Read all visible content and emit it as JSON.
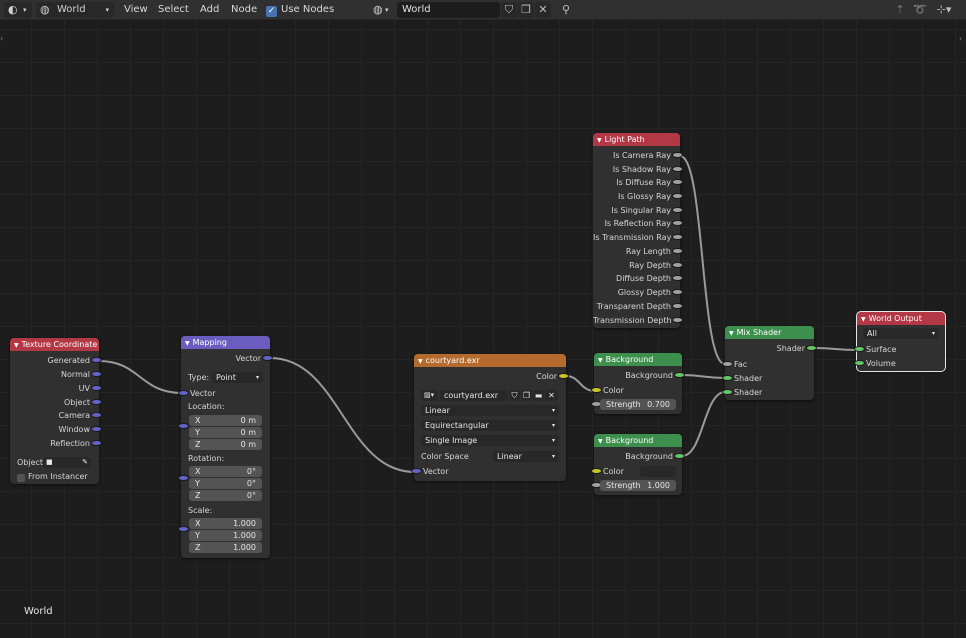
{
  "header": {
    "editor_type_icon": "world-shader-icon",
    "shader_type": "World",
    "menus": [
      "View",
      "Select",
      "Add",
      "Node"
    ],
    "use_nodes_label": "Use Nodes",
    "use_nodes_checked": true,
    "world_name": "World"
  },
  "footer": {
    "context_label": "World"
  },
  "nodes": {
    "texcoord": {
      "title": "Texture Coordinate",
      "outputs": [
        "Generated",
        "Normal",
        "UV",
        "Object",
        "Camera",
        "Window",
        "Reflection"
      ],
      "object_label": "Object:",
      "from_instancer": "From Instancer"
    },
    "mapping": {
      "title": "Mapping",
      "output": "Vector",
      "type_label": "Type:",
      "type_value": "Point",
      "vector_input": "Vector",
      "location_label": "Location:",
      "rotation_label": "Rotation:",
      "scale_label": "Scale:",
      "location": [
        {
          "axis": "X",
          "value": "0 m"
        },
        {
          "axis": "Y",
          "value": "0 m"
        },
        {
          "axis": "Z",
          "value": "0 m"
        }
      ],
      "rotation": [
        {
          "axis": "X",
          "value": "0°"
        },
        {
          "axis": "Y",
          "value": "0°"
        },
        {
          "axis": "Z",
          "value": "0°"
        }
      ],
      "scale": [
        {
          "axis": "X",
          "value": "1.000"
        },
        {
          "axis": "Y",
          "value": "1.000"
        },
        {
          "axis": "Z",
          "value": "1.000"
        }
      ]
    },
    "image": {
      "title": "courtyard.exr",
      "output": "Color",
      "image_name": "courtyard.exr",
      "interpolation": "Linear",
      "projection": "Equirectangular",
      "source": "Single Image",
      "color_space_label": "Color Space",
      "color_space": "Linear",
      "vector_input": "Vector"
    },
    "lightpath": {
      "title": "Light Path",
      "outputs": [
        "Is Camera Ray",
        "Is Shadow Ray",
        "Is Diffuse Ray",
        "Is Glossy Ray",
        "Is Singular Ray",
        "Is Reflection Ray",
        "Is Transmission Ray",
        "Ray Length",
        "Ray Depth",
        "Diffuse Depth",
        "Glossy Depth",
        "Transparent Depth",
        "Transmission Depth"
      ]
    },
    "bg1": {
      "title": "Background",
      "output": "Background",
      "color_label": "Color",
      "strength_label": "Strength",
      "strength": "0.700"
    },
    "bg2": {
      "title": "Background",
      "output": "Background",
      "color_label": "Color",
      "strength_label": "Strength",
      "strength": "1.000"
    },
    "mix": {
      "title": "Mix Shader",
      "output": "Shader",
      "inputs": [
        "Fac",
        "Shader",
        "Shader"
      ]
    },
    "output": {
      "title": "World Output",
      "target": "All",
      "inputs": [
        "Surface",
        "Volume"
      ]
    }
  },
  "colors": {
    "shader_socket": "#63c763",
    "vector_socket": "#6363c7",
    "color_socket": "#c7c729",
    "float_socket": "#a1a1a1",
    "accent": "#4772b3"
  }
}
